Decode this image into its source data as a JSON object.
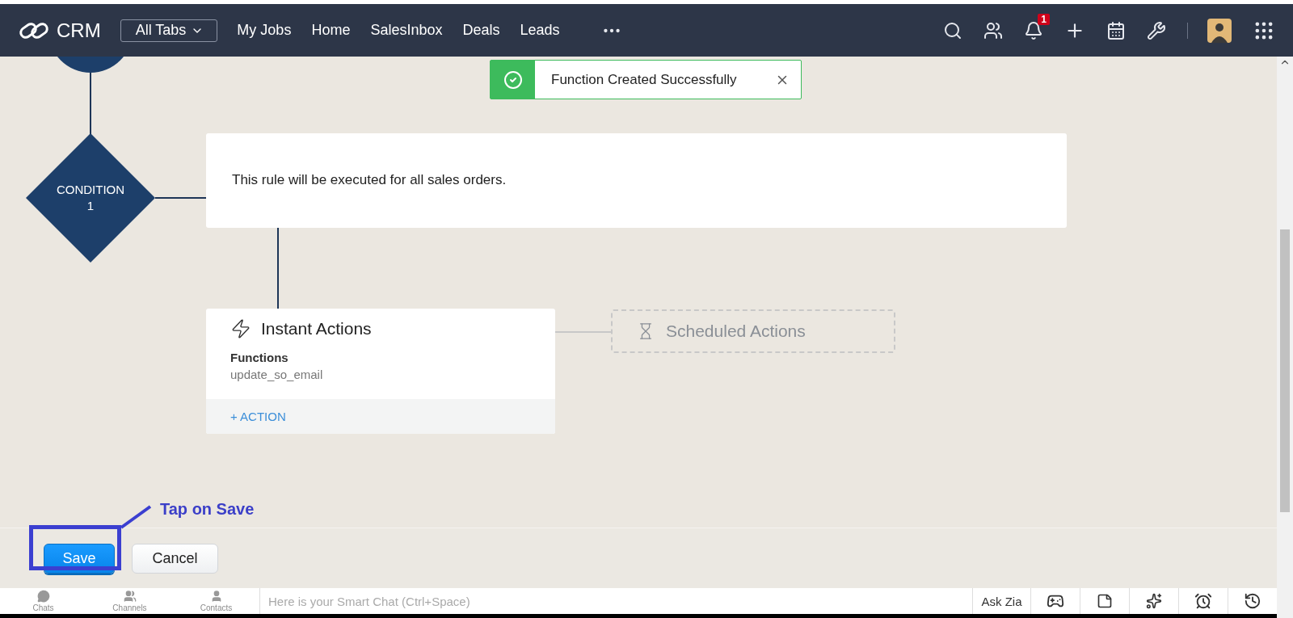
{
  "header": {
    "logo": "CRM",
    "all_tabs": "All Tabs",
    "nav": [
      "My Jobs",
      "Home",
      "SalesInbox",
      "Deals",
      "Leads"
    ],
    "notification_count": "1"
  },
  "toast": {
    "message": "Function Created Successfully"
  },
  "diagram": {
    "condition": {
      "label": "CONDITION",
      "number": "1"
    },
    "rule_text": "This rule will be executed for all sales orders.",
    "instant_actions": {
      "title": "Instant Actions",
      "section": "Functions",
      "function": "update_so_email",
      "add": "+ ACTION"
    },
    "scheduled_actions": {
      "title": "Scheduled Actions"
    }
  },
  "buttons": [
    {
      "label": "Save",
      "kind": "primary"
    },
    {
      "label": "Cancel",
      "kind": "secondary"
    }
  ],
  "annotation": {
    "text": "Tap on Save"
  },
  "chat_bar": {
    "tabs": [
      "Chats",
      "Channels",
      "Contacts"
    ],
    "placeholder": "Here is your Smart Chat (Ctrl+Space)",
    "ask": "Ask Zia"
  }
}
